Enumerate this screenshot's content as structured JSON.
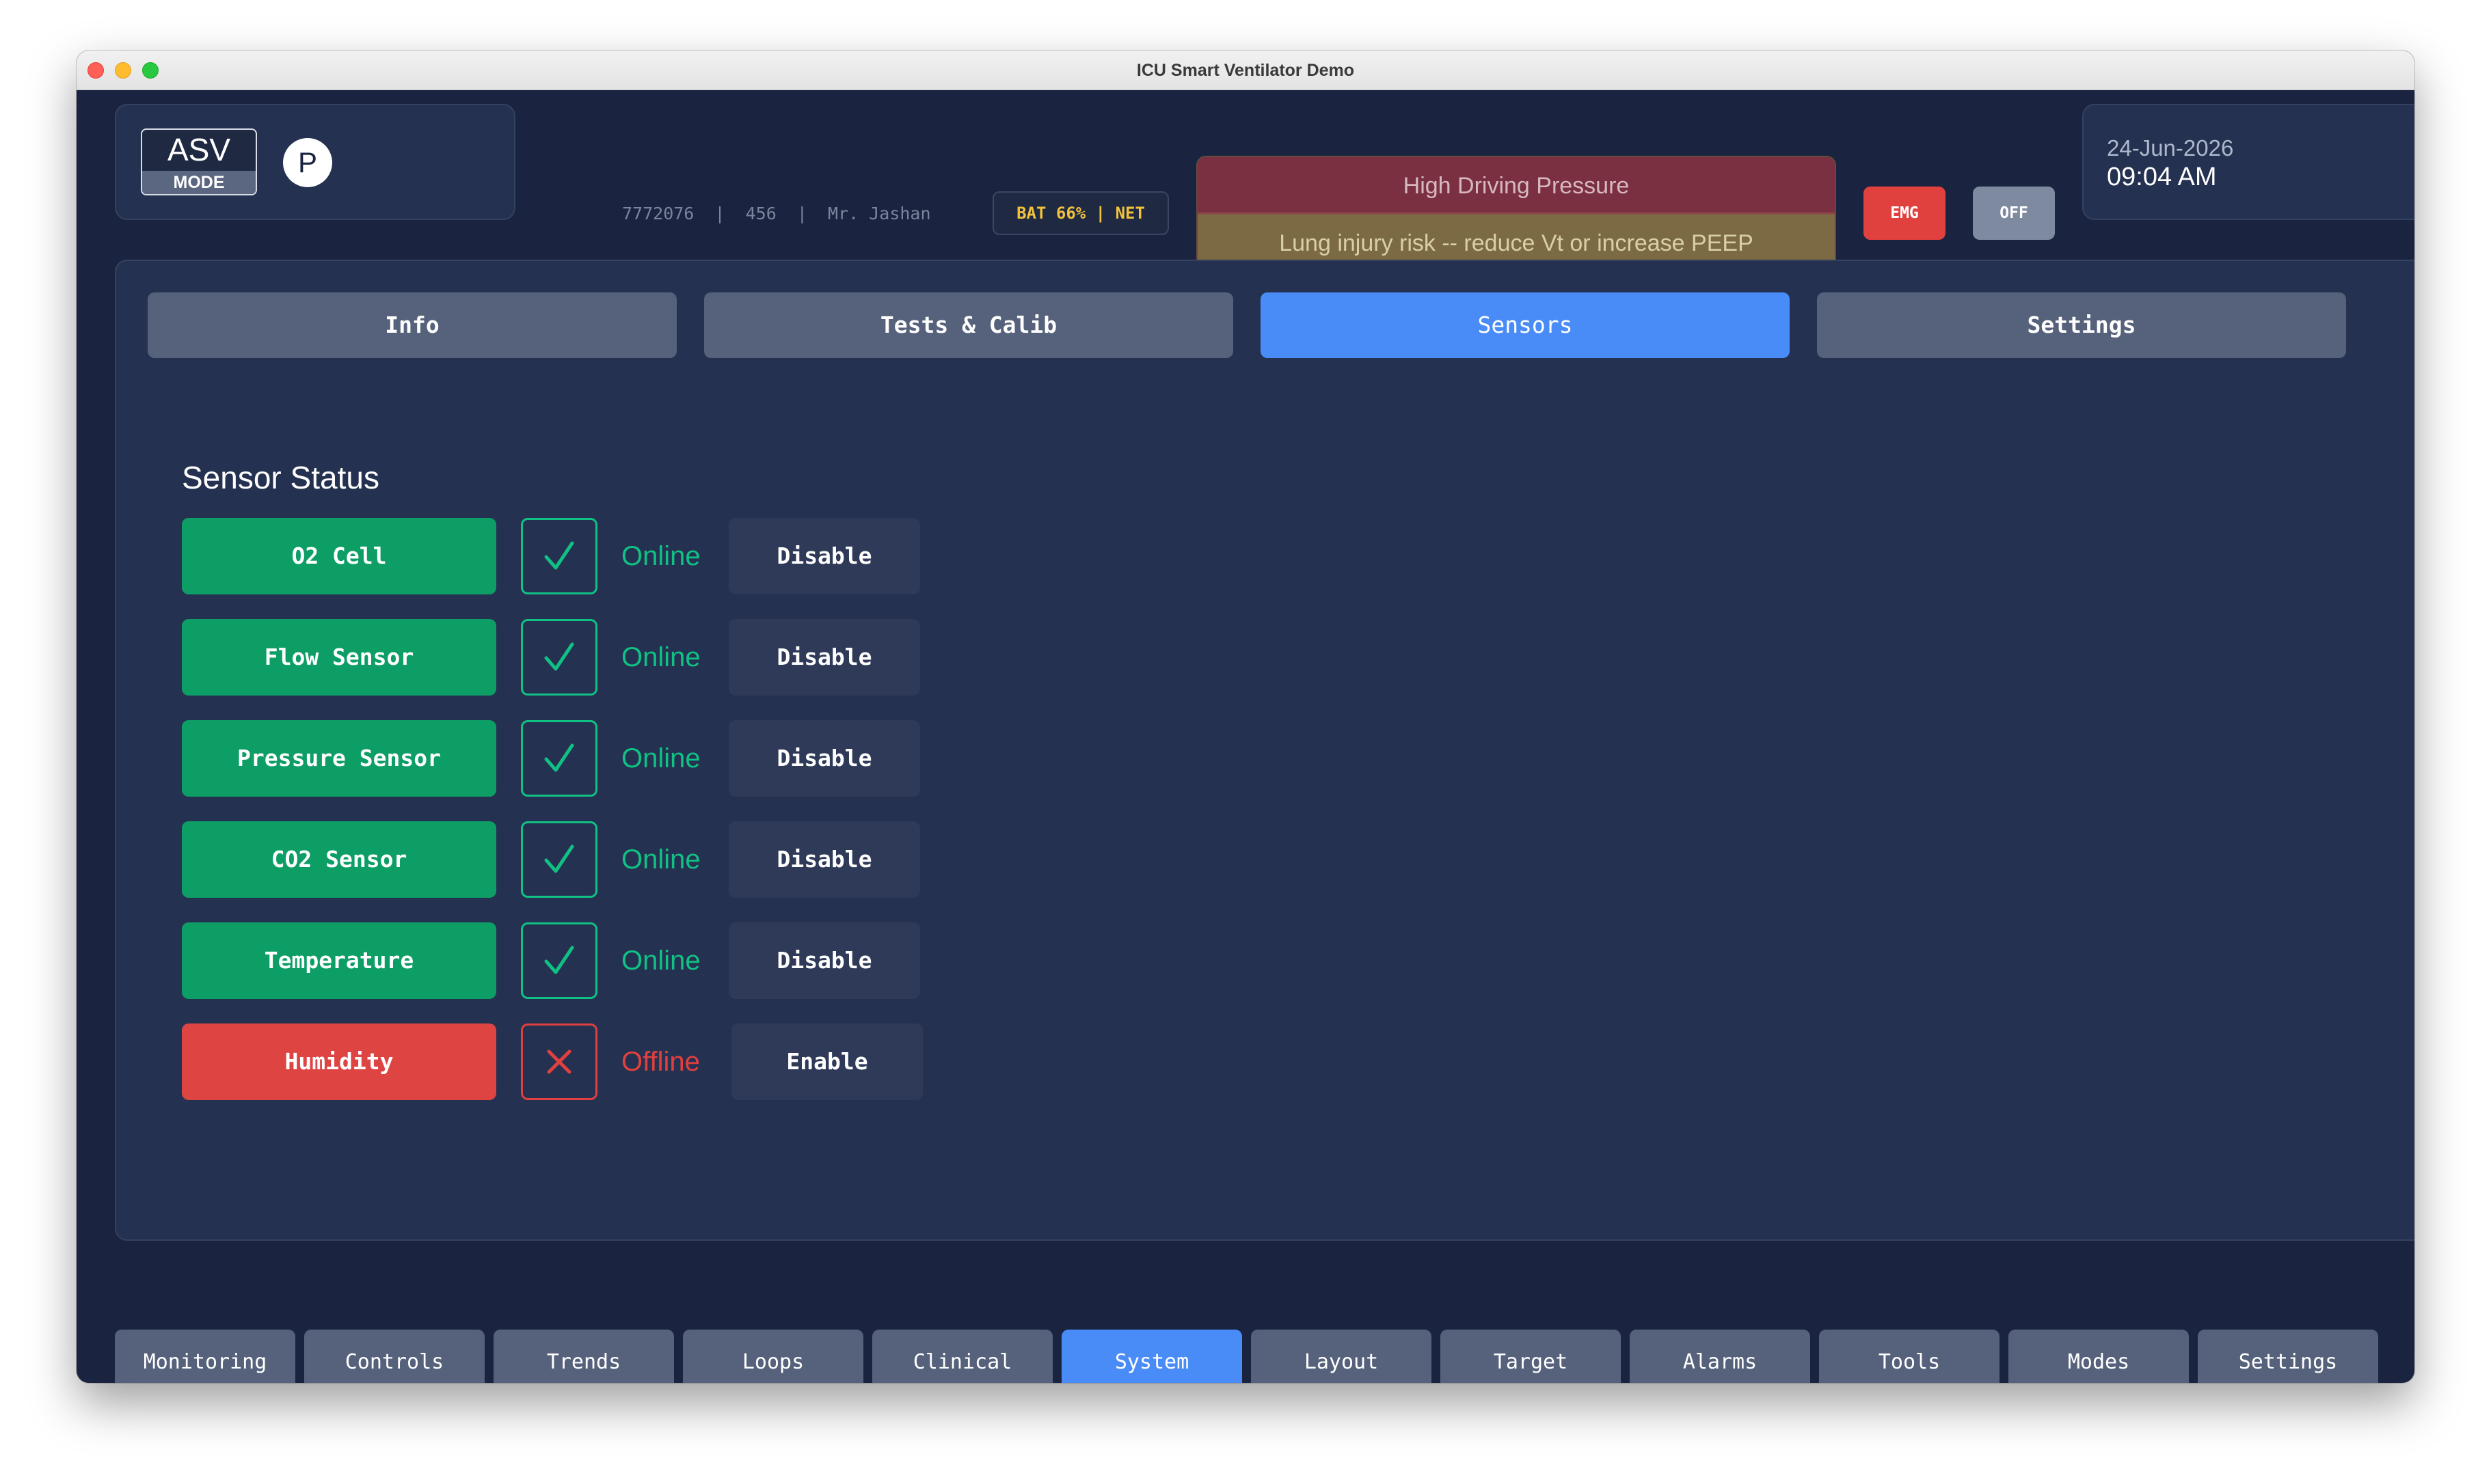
{
  "window": {
    "title": "ICU Smart Ventilator Demo"
  },
  "header": {
    "mode_name": "ASV",
    "mode_label": "MODE",
    "profile_initial": "P",
    "patient_info": "7772076  |  456  |  Mr. Jashan",
    "battery_status": "BAT 66% | NET",
    "alarm_title": "High Driving Pressure",
    "alarm_message": "Lung injury risk -- reduce Vt or increase PEEP",
    "emg_label": "EMG",
    "off_label": "OFF",
    "date": "24-Jun-2026",
    "time": "09:04 AM"
  },
  "tabs": [
    {
      "label": "Info",
      "active": false
    },
    {
      "label": "Tests & Calib",
      "active": false
    },
    {
      "label": "Sensors",
      "active": true
    },
    {
      "label": "Settings",
      "active": false
    }
  ],
  "sensors": {
    "title": "Sensor Status",
    "items": [
      {
        "name": "O2 Cell",
        "status": "Online",
        "action": "Disable"
      },
      {
        "name": "Flow Sensor",
        "status": "Online",
        "action": "Disable"
      },
      {
        "name": "Pressure Sensor",
        "status": "Online",
        "action": "Disable"
      },
      {
        "name": "CO2 Sensor",
        "status": "Online",
        "action": "Disable"
      },
      {
        "name": "Temperature",
        "status": "Online",
        "action": "Disable"
      },
      {
        "name": "Humidity",
        "status": "Offline",
        "action": "Enable"
      }
    ]
  },
  "nav": [
    {
      "label": "Monitoring",
      "active": false
    },
    {
      "label": "Controls",
      "active": false
    },
    {
      "label": "Trends",
      "active": false
    },
    {
      "label": "Loops",
      "active": false
    },
    {
      "label": "Clinical",
      "active": false
    },
    {
      "label": "System",
      "active": true
    },
    {
      "label": "Layout",
      "active": false
    },
    {
      "label": "Target",
      "active": false
    },
    {
      "label": "Alarms",
      "active": false
    },
    {
      "label": "Tools",
      "active": false
    },
    {
      "label": "Modes",
      "active": false
    },
    {
      "label": "Settings",
      "active": false
    }
  ],
  "colors": {
    "background": "#1a2440",
    "panel": "#253150",
    "accent": "#4a8cf7",
    "online": "#10c184",
    "offline": "#e0403e",
    "warning": "#f2c23a"
  }
}
